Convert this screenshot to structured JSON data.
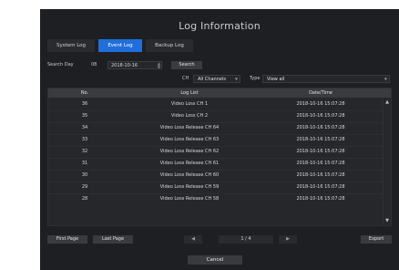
{
  "dialog": {
    "title": "Log Information",
    "tabs": [
      {
        "label": "System Log",
        "active": false
      },
      {
        "label": "Event Log",
        "active": true
      },
      {
        "label": "Backup Log",
        "active": false
      }
    ],
    "search": {
      "label": "Search Day",
      "date_prefix": "08",
      "date_value": "2018-10-16",
      "button": "Search"
    },
    "filter": {
      "ch_label": "CH",
      "ch_value": "All Channels",
      "type_label": "Type",
      "type_value": "View all"
    },
    "table": {
      "headers": [
        "No.",
        "Log List",
        "Date/Time"
      ],
      "rows": [
        {
          "no": "36",
          "log": "Video Loss CH 1",
          "time": "2018-10-16 15:07:28"
        },
        {
          "no": "35",
          "log": "Video Loss CH 2",
          "time": "2018-10-16 15:07:28"
        },
        {
          "no": "34",
          "log": "Video Loss Release CH 64",
          "time": "2018-10-16 15:07:28"
        },
        {
          "no": "33",
          "log": "Video Loss Release CH 63",
          "time": "2018-10-16 15:07:28"
        },
        {
          "no": "32",
          "log": "Video Loss Release CH 62",
          "time": "2018-10-16 15:07:28"
        },
        {
          "no": "31",
          "log": "Video Loss Release CH 61",
          "time": "2018-10-16 15:07:28"
        },
        {
          "no": "30",
          "log": "Video Loss Release CH 60",
          "time": "2018-10-16 15:07:28"
        },
        {
          "no": "29",
          "log": "Video Loss Release CH 59",
          "time": "2018-10-16 15:07:28"
        },
        {
          "no": "28",
          "log": "Video Loss Release CH 58",
          "time": "2018-10-16 15:07:28"
        }
      ]
    },
    "bottom": {
      "first_page": "First Page",
      "last_page": "Last Page",
      "page_indicator": "1 / 4",
      "export": "Export"
    },
    "cancel": "Cancel",
    "colors": {
      "background": "#1e1f22",
      "accent": "#1f6edb"
    }
  }
}
